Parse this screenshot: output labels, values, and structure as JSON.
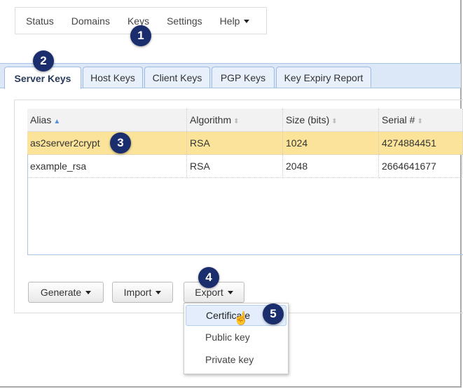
{
  "nav": {
    "items": [
      "Status",
      "Domains",
      "Keys",
      "Settings",
      "Help"
    ]
  },
  "tabs": [
    "Server Keys",
    "Host Keys",
    "Client Keys",
    "PGP Keys",
    "Key Expiry Report"
  ],
  "table": {
    "columns": [
      "Alias",
      "Algorithm",
      "Size (bits)",
      "Serial #"
    ],
    "rows": [
      [
        "as2server2crypt",
        "RSA",
        "1024",
        "4274884451"
      ],
      [
        "example_rsa",
        "RSA",
        "2048",
        "2664641677"
      ]
    ],
    "selected_row": 0,
    "sorted_by": "Alias"
  },
  "buttons": {
    "generate": "Generate",
    "import": "Import",
    "export": "Export"
  },
  "export_menu": [
    "Certificate",
    "Public key",
    "Private key"
  ],
  "badges": [
    "1",
    "2",
    "3",
    "4",
    "5"
  ]
}
